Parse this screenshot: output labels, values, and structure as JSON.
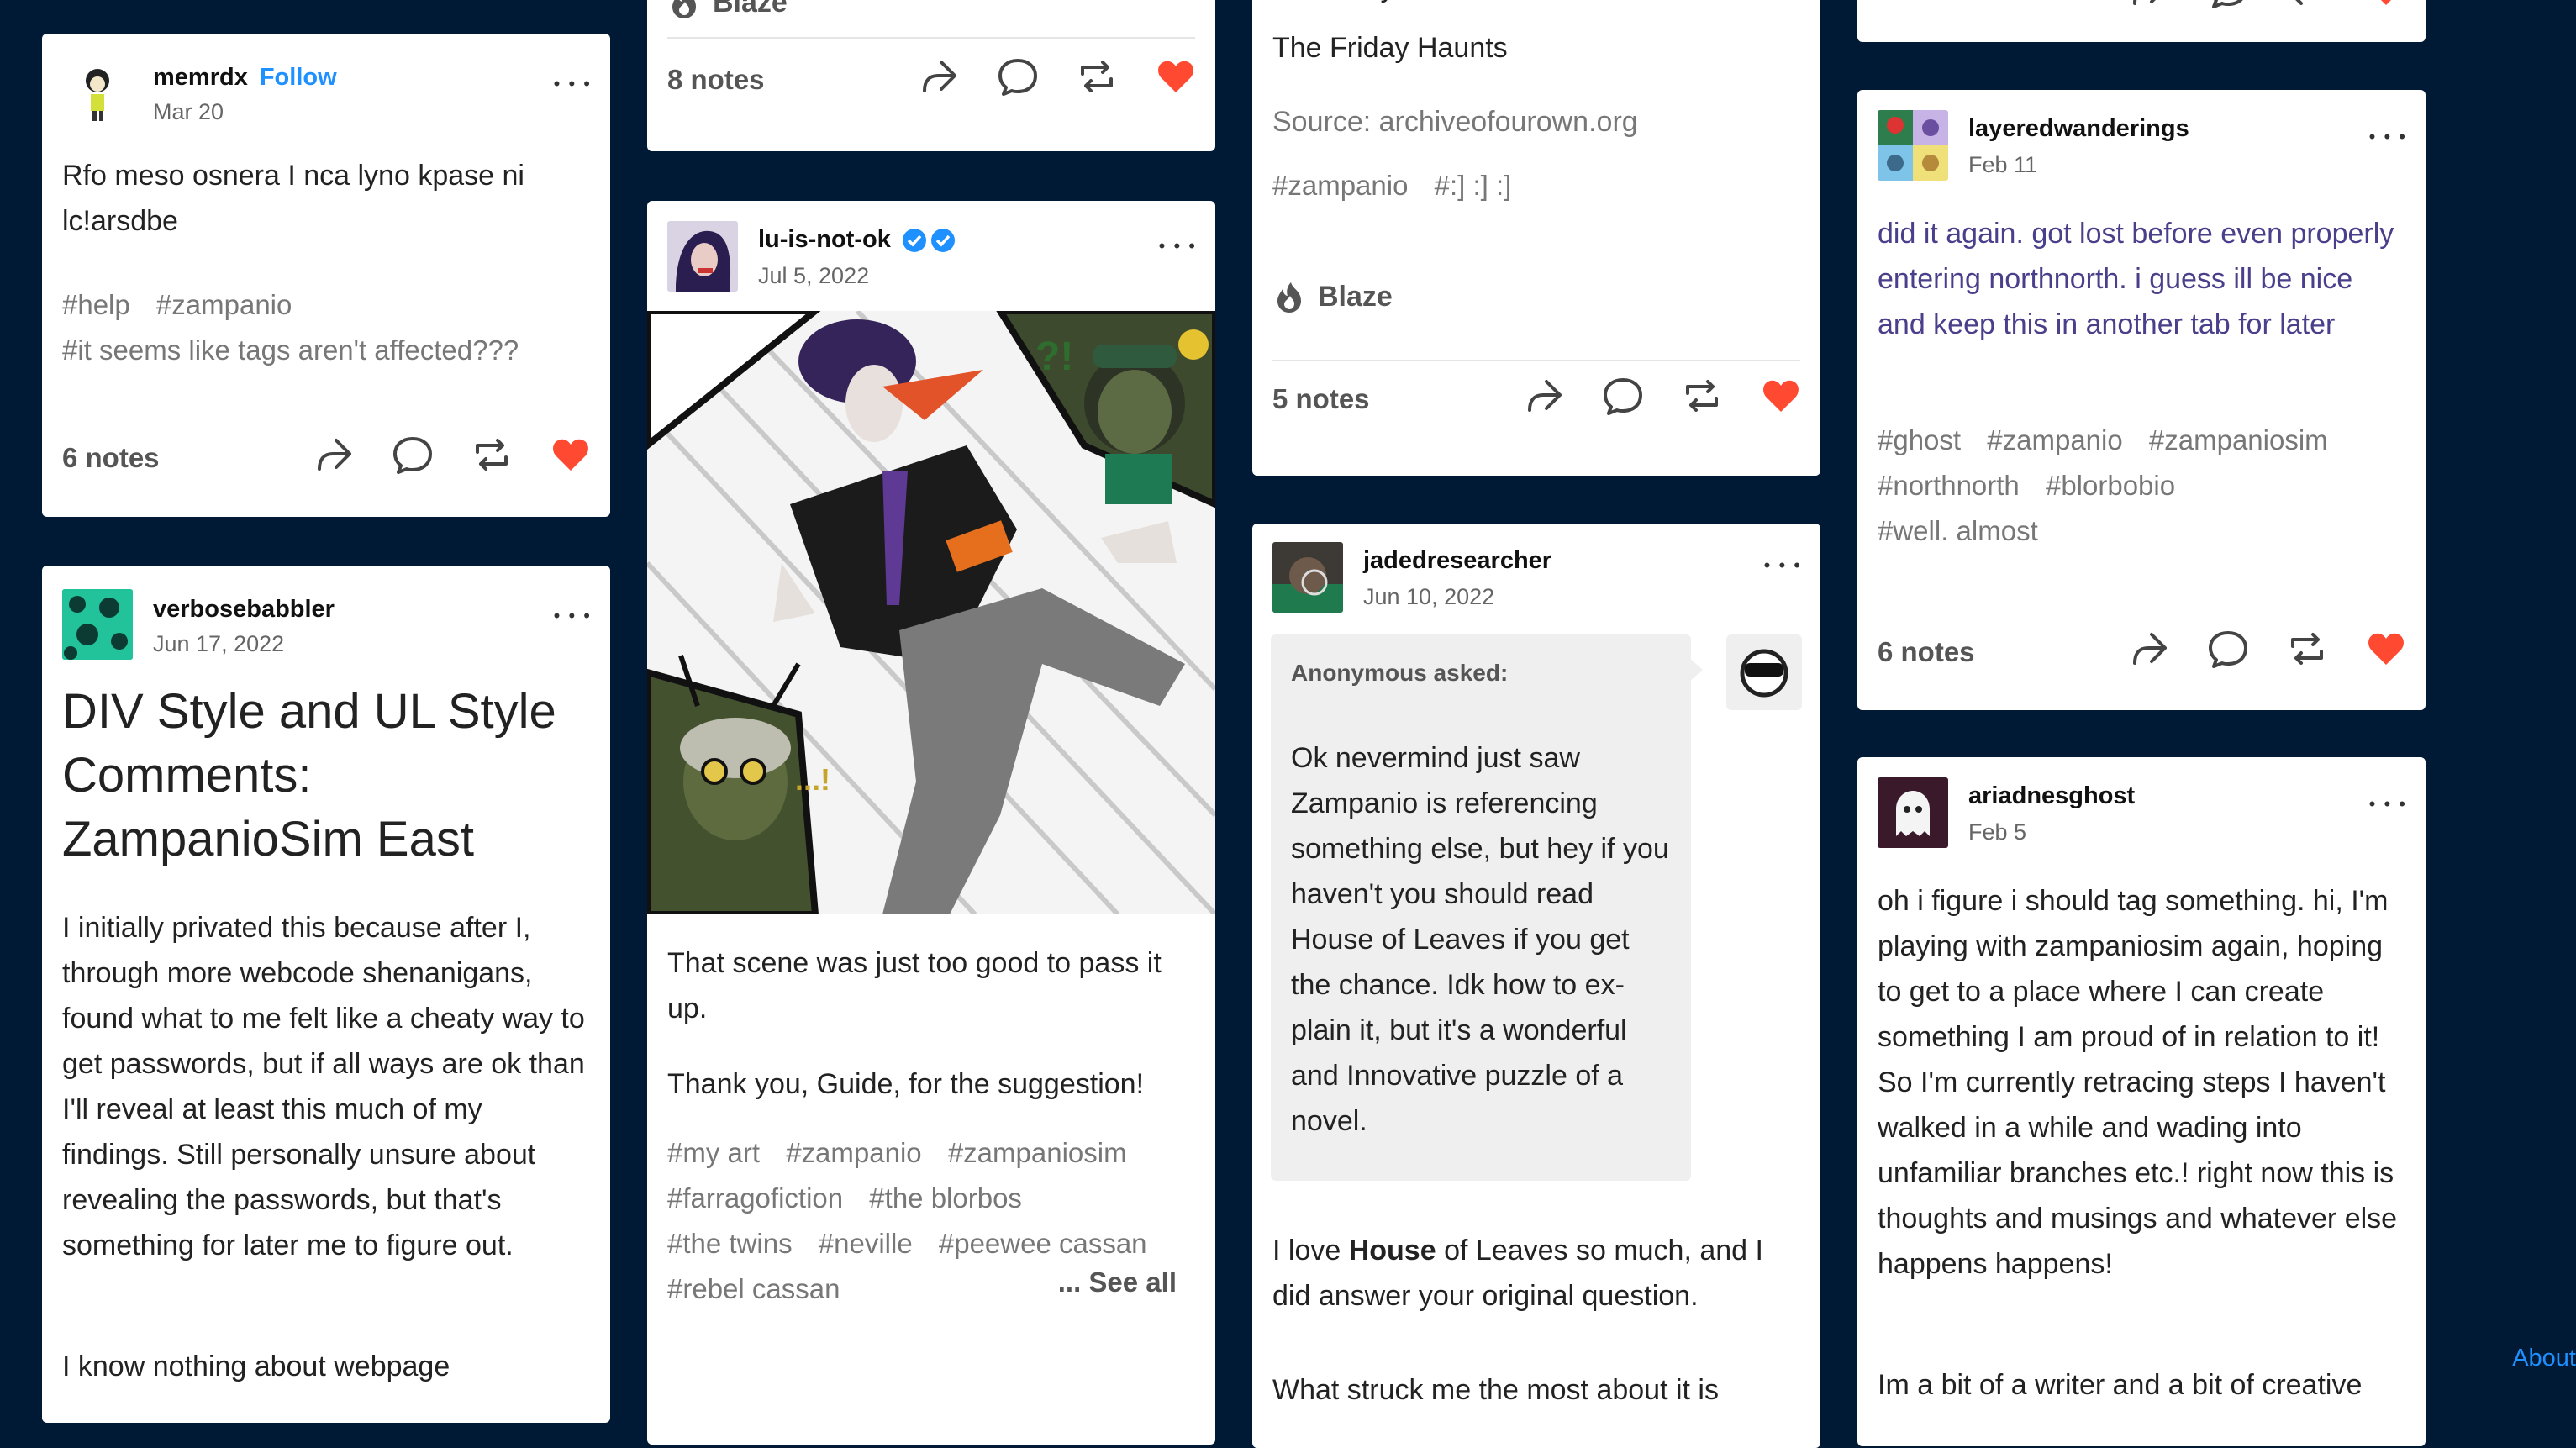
{
  "posts": {
    "memrdx": {
      "username": "memrdx",
      "follow": "Follow",
      "date": "Mar 20",
      "text": "Rfo meso osnera I nca lyno kpase ni lc!arsdbe",
      "tags": [
        "#help",
        "#zampanio",
        "#it seems like tags aren't affected???"
      ],
      "notes": "6 notes"
    },
    "verbose": {
      "username": "verbosebabbler",
      "date": "Jun 17, 2022",
      "title": "DIV Style and UL Style Comments: ZampanioSim East",
      "para1": "I initially privated this because after I, through more webcode shenanigans, found what to me felt like a cheaty way to get passwords, but if all ways are ok than I'll reveal at least this much of my findings. Still personally unsure about revealing the passwords, but that's something for later me to figure out.",
      "para2": "I know nothing about webpage"
    },
    "top2": {
      "blaze": "Blaze",
      "notes": "8 notes"
    },
    "lu": {
      "username": "lu-is-not-ok",
      "date": "Jul 5, 2022",
      "text1": "That scene was just too good to pass it up.",
      "text2": "Thank you, Guide, for the suggestion!",
      "tags": [
        "#my art",
        "#zampanio",
        "#zampaniosim",
        "#farragofiction",
        "#the blorbos",
        "#the twins",
        "#neville",
        "#peewee cassan",
        "#rebel cassan"
      ],
      "see_all": "... See all",
      "art_mark1": "?!",
      "art_mark2": "...!"
    },
    "friday": {
      "summary": "Summary:",
      "title": "The Friday Haunts",
      "source": "Source: archiveofourown.org",
      "tags": [
        "#zampanio",
        "#:] :] :]"
      ],
      "blaze": "Blaze",
      "notes": "5 notes"
    },
    "jaded": {
      "username": "jadedresearcher",
      "date": "Jun 10, 2022",
      "asker": "Anonymous asked:",
      "question": "Ok nevermind just saw Zampanio is referencing something else, but hey if you haven't you should read House of Leaves if you get the chance. Idk how to ex-plain it, but it's a wonderful and Innovative puzzle of a novel.",
      "answer_pre": "I love ",
      "answer_bold": "House",
      "answer_post": " of Leaves so much, and I did answer your original question.",
      "answer2": "What struck me the most about it is"
    },
    "layered": {
      "username": "layeredwanderings",
      "date": "Feb 11",
      "text": "did it again. got lost before even properly entering northnorth. i guess ill be nice and keep this in another tab for later",
      "tags": [
        "#ghost",
        "#zampanio",
        "#zampaniosim",
        "#northnorth",
        "#blorbobio",
        "#well. almost"
      ],
      "notes": "6 notes"
    },
    "ariadne": {
      "username": "ariadnesghost",
      "date": "Feb 5",
      "text": "oh i figure i should tag something. hi, I'm playing with zampaniosim again, hoping to get to a place where I can create something I am proud of in relation to it! So I'm currently retracing steps I haven't walked in a while and wading into unfamiliar branches etc.! right now this is thoughts and musings and whatever else happens happens!",
      "text2": "Im a bit of a writer and a bit of creative"
    }
  },
  "footer": {
    "about": "About"
  },
  "colors": {
    "background": "#001935",
    "like": "#ff4930",
    "link": "#1e90ff"
  },
  "icons": [
    "share-icon",
    "reply-icon",
    "reblog-icon",
    "heart-icon",
    "more-icon",
    "blaze-icon",
    "verified-icon"
  ]
}
